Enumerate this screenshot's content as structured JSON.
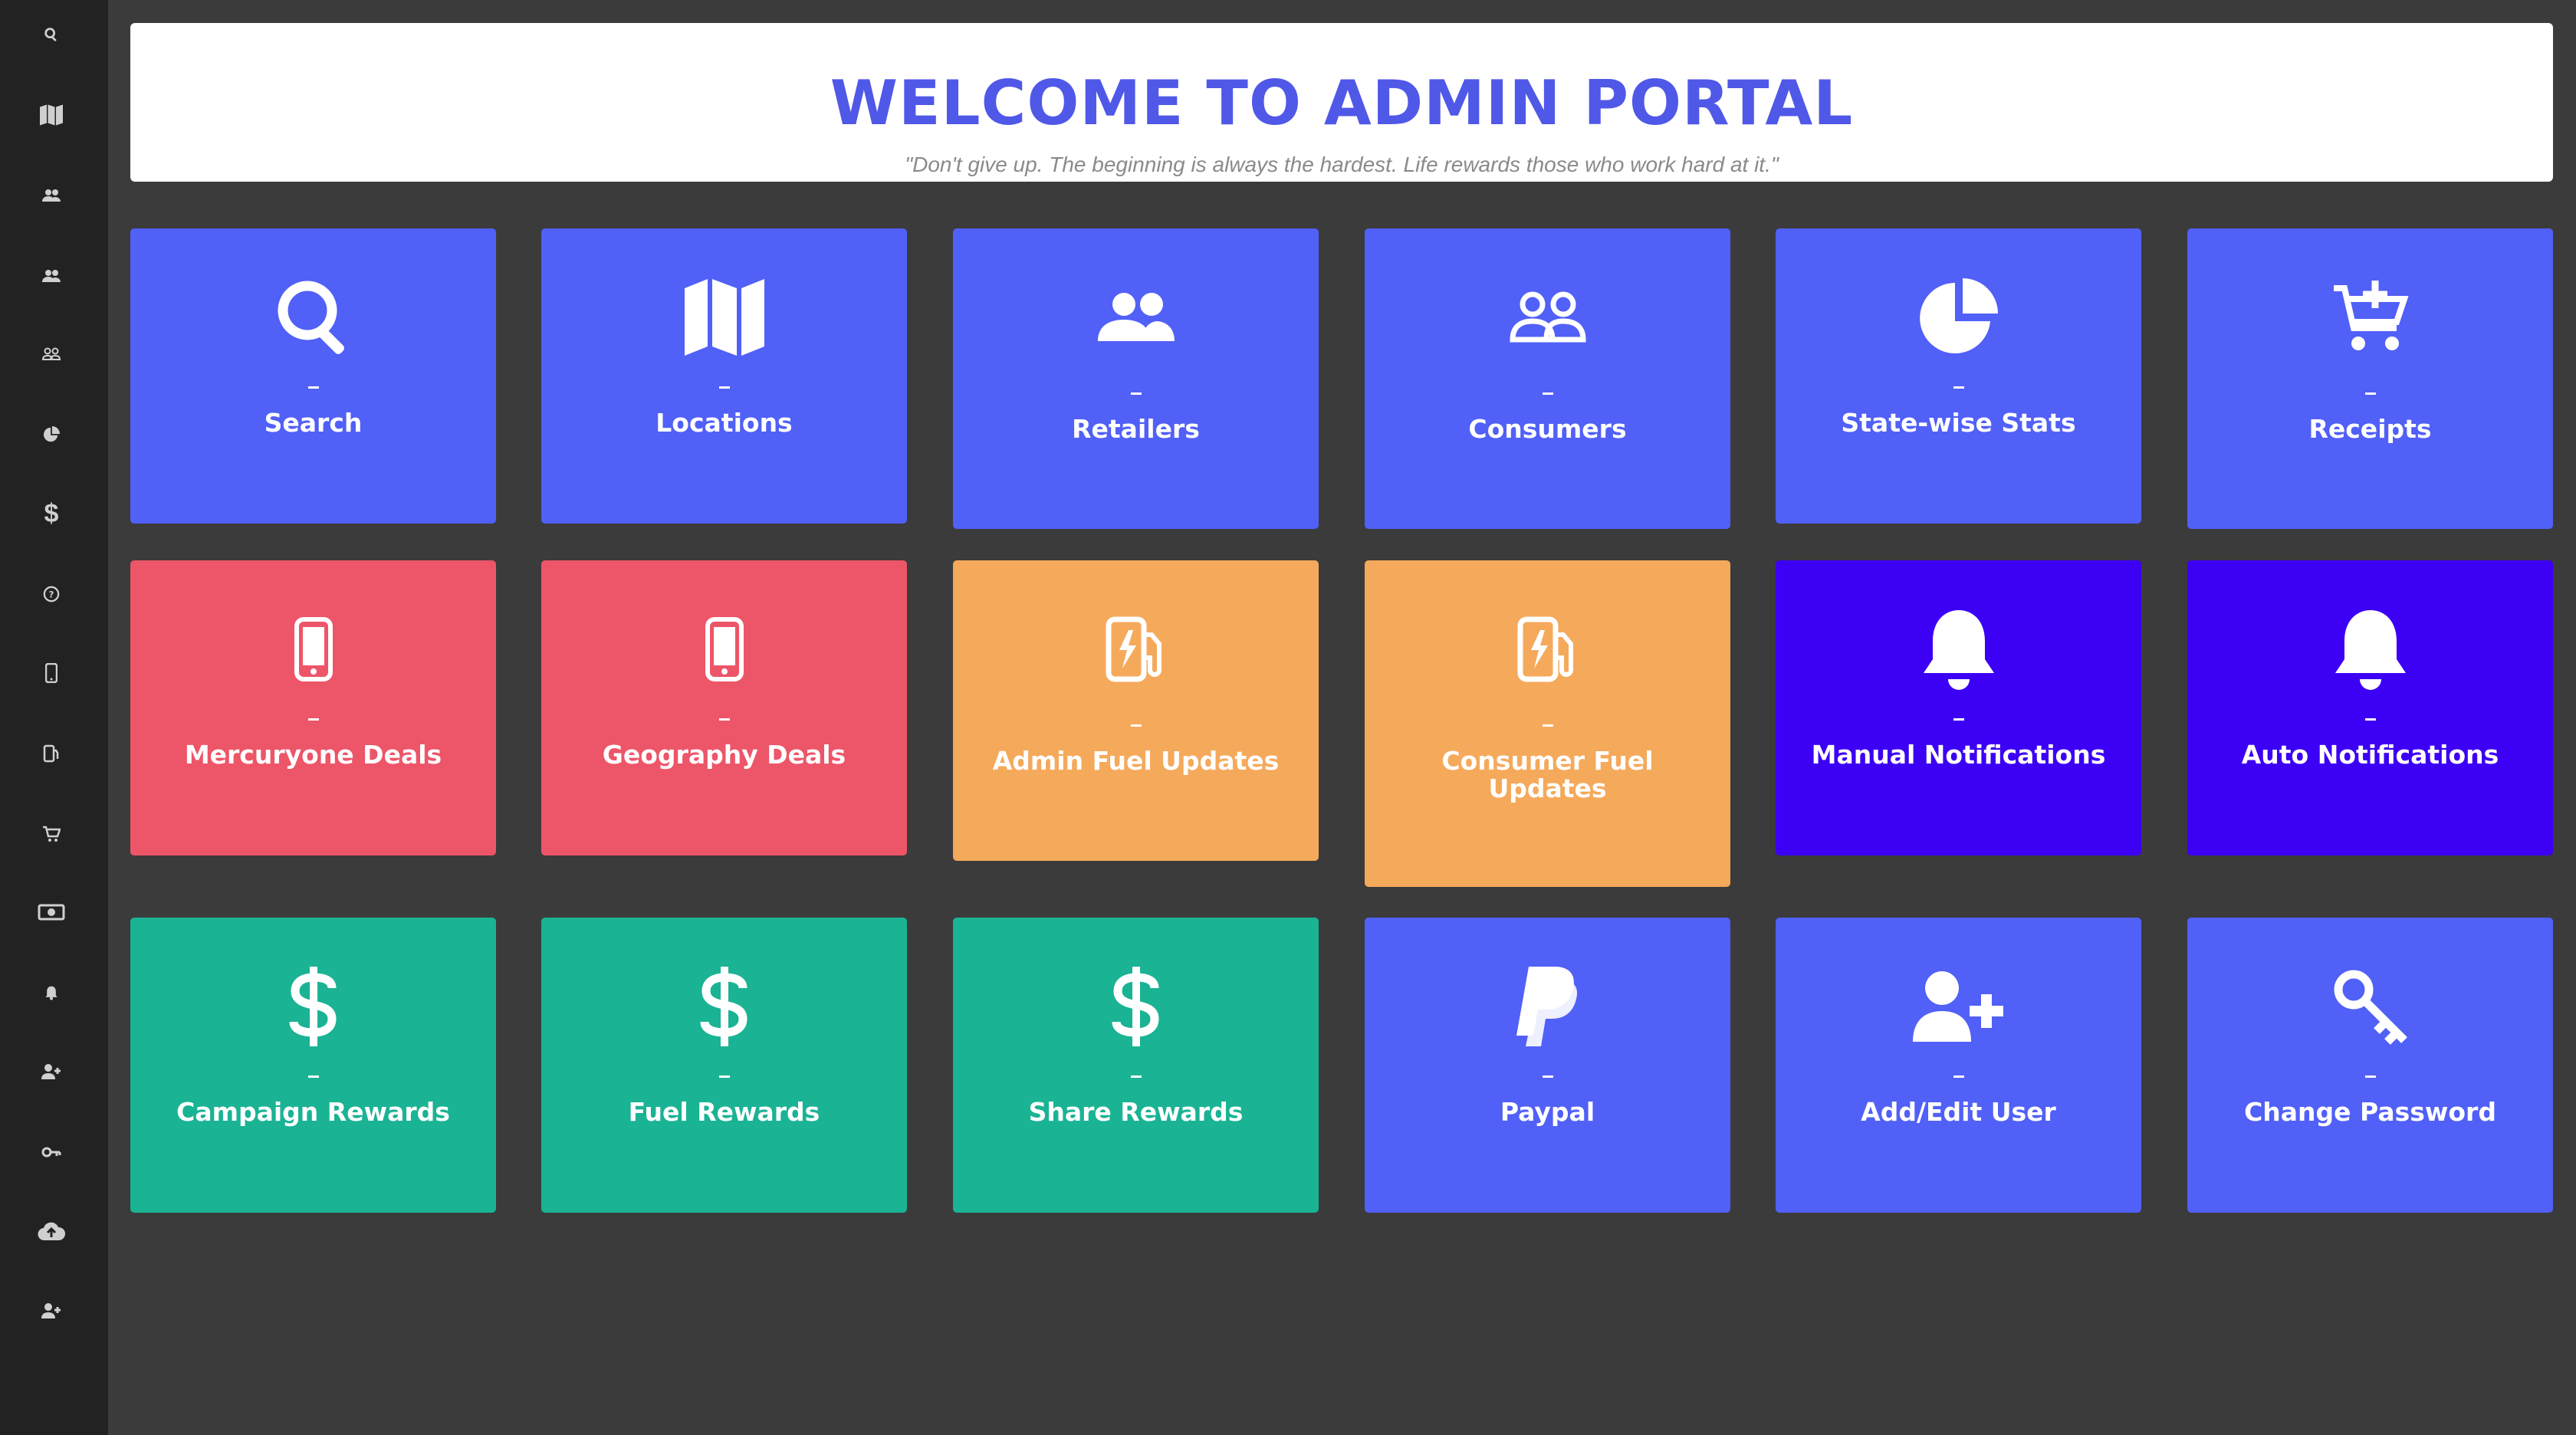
{
  "header": {
    "title": "WELCOME TO ADMIN PORTAL",
    "quote": "\"Don't give up. The beginning is always the hardest. Life rewards those who work hard at it.\""
  },
  "sidebar": {
    "items": [
      {
        "icon": "search-icon"
      },
      {
        "icon": "map-icon"
      },
      {
        "icon": "users-icon"
      },
      {
        "icon": "users-icon"
      },
      {
        "icon": "users-outline-icon"
      },
      {
        "icon": "pie-chart-icon"
      },
      {
        "icon": "dollar-icon"
      },
      {
        "icon": "help-icon"
      },
      {
        "icon": "mobile-icon"
      },
      {
        "icon": "fuel-pump-icon"
      },
      {
        "icon": "cart-plus-icon"
      },
      {
        "icon": "money-bill-icon"
      },
      {
        "icon": "bell-icon"
      },
      {
        "icon": "user-plus-icon"
      },
      {
        "icon": "key-icon"
      },
      {
        "icon": "cloud-upload-icon"
      },
      {
        "icon": "user-plus-icon"
      }
    ]
  },
  "tiles": [
    {
      "label": "Search",
      "dash": "–",
      "icon": "search-icon",
      "color": "#5160f7"
    },
    {
      "label": "Locations",
      "dash": "–",
      "icon": "map-icon",
      "color": "#5160f7"
    },
    {
      "label": "Retailers",
      "dash": "–",
      "icon": "users-icon",
      "color": "#5160f7"
    },
    {
      "label": "Consumers",
      "dash": "–",
      "icon": "users-outline-icon",
      "color": "#5160f7"
    },
    {
      "label": "State-wise Stats",
      "dash": "–",
      "icon": "pie-chart-icon",
      "color": "#5160f7"
    },
    {
      "label": "Receipts",
      "dash": "–",
      "icon": "cart-plus-icon",
      "color": "#5160f7"
    },
    {
      "label": "Mercuryone Deals",
      "dash": "–",
      "icon": "mobile-icon",
      "color": "#ed5568"
    },
    {
      "label": "Geography Deals",
      "dash": "–",
      "icon": "mobile-icon",
      "color": "#ed5568"
    },
    {
      "label": "Admin Fuel Updates",
      "dash": "–",
      "icon": "fuel-pump-icon",
      "color": "#f5a95b"
    },
    {
      "label": "Consumer Fuel Updates",
      "dash": "–",
      "icon": "fuel-pump-icon",
      "color": "#f5a95b"
    },
    {
      "label": "Manual Notifications",
      "dash": "–",
      "icon": "bell-icon",
      "color": "#3c00f5"
    },
    {
      "label": "Auto Notifications",
      "dash": "–",
      "icon": "bell-icon",
      "color": "#3c00f5"
    },
    {
      "label": "Campaign Rewards",
      "dash": "–",
      "icon": "dollar-icon",
      "color": "#1ab394"
    },
    {
      "label": "Fuel Rewards",
      "dash": "–",
      "icon": "dollar-icon",
      "color": "#1ab394"
    },
    {
      "label": "Share Rewards",
      "dash": "–",
      "icon": "dollar-icon",
      "color": "#1ab394"
    },
    {
      "label": "Paypal",
      "dash": "–",
      "icon": "paypal-icon",
      "color": "#5160f7"
    },
    {
      "label": "Add/Edit User",
      "dash": "–",
      "icon": "user-plus-icon",
      "color": "#5160f7"
    },
    {
      "label": "Change Password",
      "dash": "–",
      "icon": "key-icon",
      "color": "#5160f7"
    }
  ]
}
